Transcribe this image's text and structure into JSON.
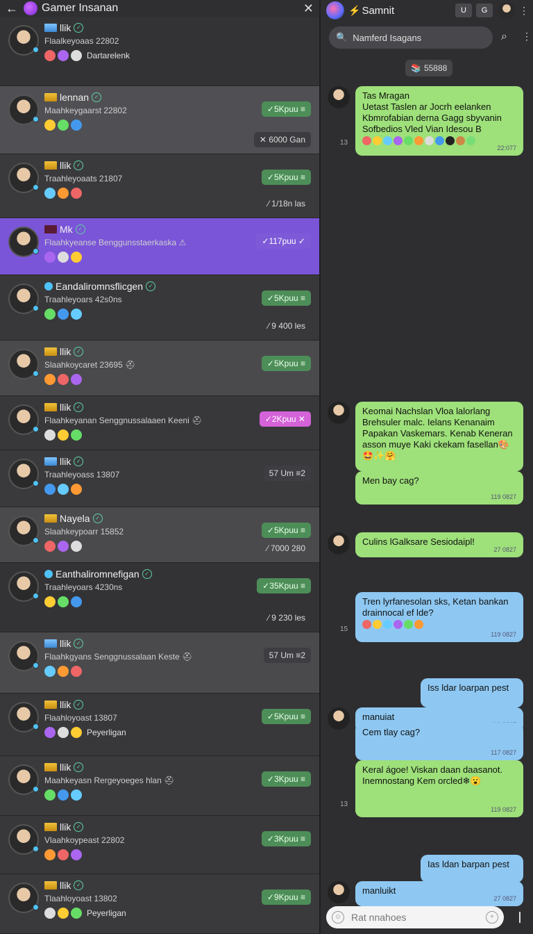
{
  "left_header": {
    "back": "←",
    "title": "Gamer Insanan",
    "close": "✕"
  },
  "social_icons": [
    "twitter-icon",
    "grid-icon",
    "shield-icon",
    "gear-icon",
    "target-icon"
  ],
  "chats": [
    {
      "name": "llik",
      "flag": "blue",
      "sub": "Flaalkeyoaas 22802",
      "extra": "Dartarelenk",
      "pill": null,
      "tag": null
    },
    {
      "name": "lennan",
      "flag": "gold",
      "sub": "Maahkeygaarst 22802",
      "extra": "",
      "pill": "✓5Kpuu ≡",
      "pill_style": "green",
      "tag": "✕ 6000 Gan"
    },
    {
      "name": "llik",
      "flag": "gold",
      "sub": "Traahleyoaats 21807",
      "extra": "",
      "pill": "✓5Kpuu ≡",
      "pill_style": "green",
      "tag": "⁄ 1/18n las"
    },
    {
      "name": "Mk",
      "flag": "dark",
      "sub": "Flaahkyeanse Benggunsstaerkaska ⚠",
      "extra": "",
      "pill": "✓117puu ✓",
      "pill_style": "purple",
      "tag": null
    },
    {
      "name": "Eandaliromnsflicgen",
      "flag": "globe",
      "sub": "Traahleyoars 42s0ns",
      "extra": "",
      "pill": "✓5Kpuu ≡",
      "pill_style": "green",
      "tag": "⁄ 9 400 les"
    },
    {
      "name": "llik",
      "flag": "gold",
      "sub": "Slaahkoycaret 23695 ⛑",
      "extra": "",
      "pill": "✓5Kpuu ≡",
      "pill_style": "green",
      "tag": null
    },
    {
      "name": "llik",
      "flag": "gold",
      "sub": "Flaahkeyanan Senggnussalaaen Keeni ⛑",
      "extra": "",
      "pill": "✓2Kpuu ✕",
      "pill_style": "pink",
      "tag": null
    },
    {
      "name": "llik",
      "flag": "blue",
      "sub": "Traahleyoass 13807",
      "extra": "",
      "pill": "57 Um ≡2",
      "pill_style": "gray",
      "tag": null
    },
    {
      "name": "Nayela",
      "flag": "gold",
      "sub": "Slaahkeypoarr 15852",
      "extra": "",
      "pill": "✓5Kpuu ≡",
      "pill_style": "green",
      "tag": "⁄ 7000 280"
    },
    {
      "name": "Eanthaliromnefigan",
      "flag": "globe",
      "sub": "Traahleyoars 4230ns",
      "extra": "",
      "pill": "✓35Kpuu ≡",
      "pill_style": "green",
      "tag": "⁄ 9 230 les"
    },
    {
      "name": "llik",
      "flag": "blue",
      "sub": "Flaahkgyans Senggnussalaan Keste ⛑",
      "extra": "",
      "pill": "57 Um ≡2",
      "pill_style": "gray",
      "tag": null
    },
    {
      "name": "llik",
      "flag": "gold",
      "sub": "Flaahloyoast 13807",
      "extra": "Peyerligan",
      "pill": "✓5Kpuu ≡",
      "pill_style": "green",
      "tag": null
    },
    {
      "name": "llik",
      "flag": "gold",
      "sub": "Maahkeyasn Rergeyoeges hlan ⛑",
      "extra": "",
      "pill": "✓3Kpuu ≡",
      "pill_style": "green",
      "tag": null
    },
    {
      "name": "llik",
      "flag": "gold",
      "sub": "Vlaahkoypeast 22802",
      "extra": "",
      "pill": "✓3Kpuu ≡",
      "pill_style": "green",
      "tag": null
    },
    {
      "name": "llik",
      "flag": "gold",
      "sub": "Tlaahloyoast 13802",
      "extra": "Peyerligan",
      "pill": "✓9Kpuu ≡",
      "pill_style": "green",
      "tag": null
    }
  ],
  "right_header": {
    "bolt": "⚡",
    "title": "Samnit",
    "btn1": "U",
    "btn2": "G",
    "more": "⋮"
  },
  "search": {
    "placeholder": "Namferd Isagans",
    "icon": "search-icon"
  },
  "count_chip": "55888",
  "messages": [
    {
      "text": "Tas Mragan\nUetast Taslen ar Jocrh eelanken Kbmrofabian derna Gagg sbyvanin Sofbedios Vled Vian Idesou B",
      "time": "22:077",
      "style": "green",
      "side": "13",
      "emojis": "◉◉◉◉◉◉◉◉◉◉◉"
    },
    {
      "text": "Keomai Nachslan Vloa lalorlang Brehsuler malc. Ielans Kenanaim Papakan Vaskemars. Kenab Keneran asson muye Kaki ckekam fasellan🎨🤩✨🤗",
      "time": "",
      "style": "green",
      "side": "",
      "emojis": ""
    },
    {
      "text": "Men bay cag?",
      "time": "119 0827",
      "style": "green",
      "side": "",
      "emojis": ""
    },
    {
      "text": "Culins lGalksare Sesiodaipl!",
      "time": "27 0827",
      "style": "green",
      "side": "",
      "emojis": ""
    },
    {
      "text": "Tren lyrfanesolan sks, Ketan bankan drainnocal ef lde?",
      "time": "119 0827",
      "style": "blue",
      "side": "15",
      "emojis": "◉◉◉◉◉◉"
    },
    {
      "text": "Iss ldar loarpan pest",
      "time": "",
      "style": "blue",
      "side": "",
      "emojis": ""
    },
    {
      "text": "manuiat",
      "time": "119 0827",
      "style": "blue",
      "side": "",
      "emojis": ""
    },
    {
      "text": "Cem tlay cag?",
      "time": "117 0827",
      "style": "blue",
      "side": "",
      "emojis": ""
    },
    {
      "text": "Keral ágoe! Viskan daan daasanot. Inemnostang Kem orcled❄😮",
      "time": "119 0827",
      "style": "green",
      "side": "13",
      "emojis": ""
    },
    {
      "text": "Ias ldan barpan pest",
      "time": "",
      "style": "blue",
      "side": "",
      "emojis": ""
    },
    {
      "text": "manluikt",
      "time": "27 0827",
      "style": "blue",
      "side": "",
      "emojis": ""
    }
  ],
  "composer": {
    "placeholder": "Rat nnahoes"
  },
  "colors": {
    "accent_purple": "#7e5ad8",
    "pill_green": "#4d8e58",
    "bubble_green": "#9ee07a",
    "bubble_blue": "#8ec8f2"
  }
}
